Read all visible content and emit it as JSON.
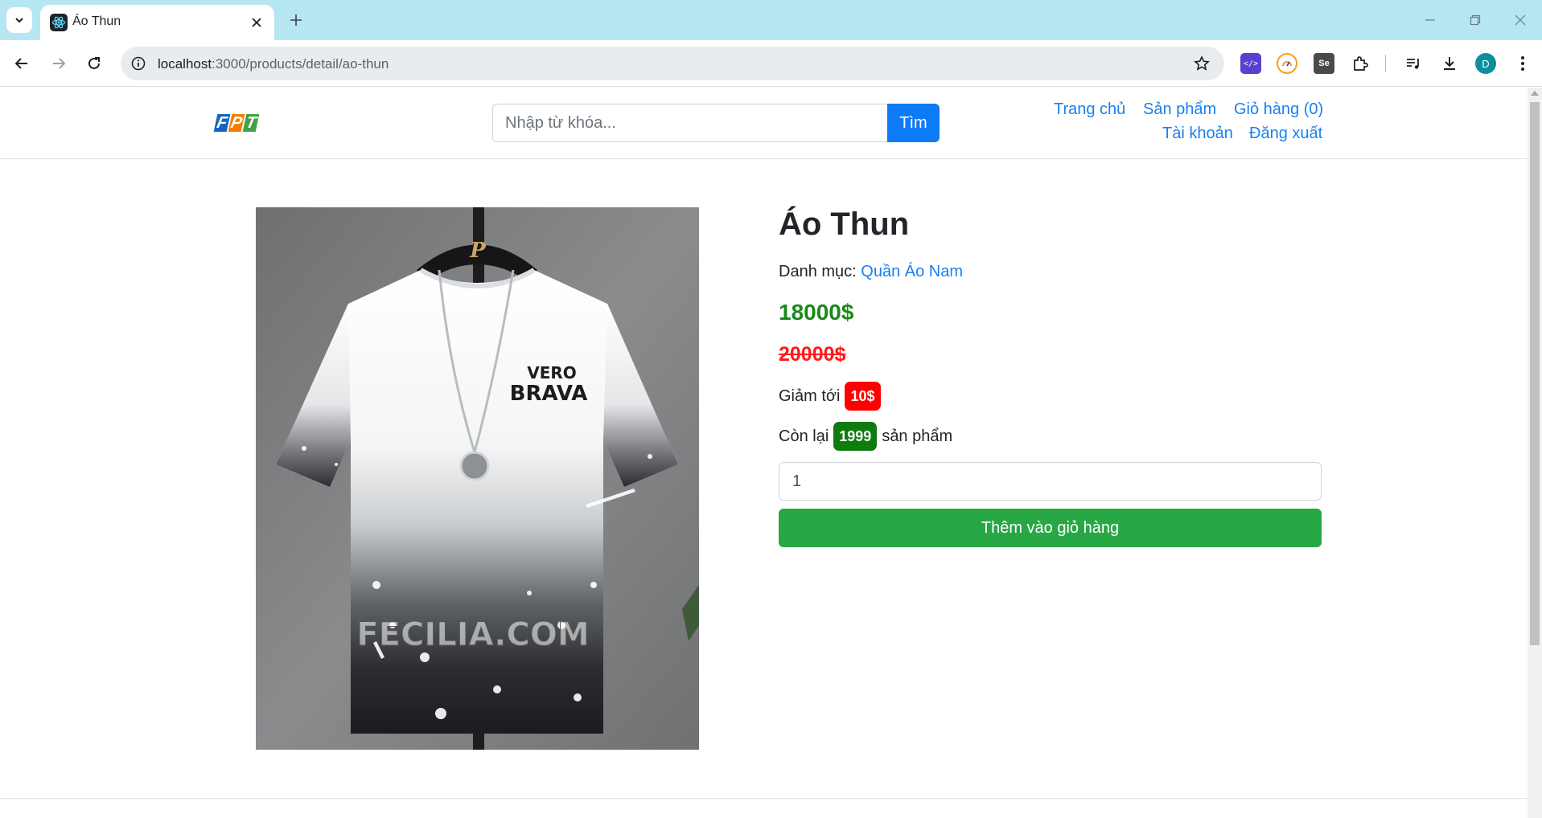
{
  "browser": {
    "tab_title": "Áo Thun",
    "url_host": "localhost",
    "url_path": ":3000/products/detail/ao-thun",
    "avatar_letter": "D",
    "ext_dev_glyph": "</>",
    "ext_se_label": "Se"
  },
  "header": {
    "logo_letters": [
      "F",
      "P",
      "T"
    ],
    "logo_colors": [
      "#1565c0",
      "#f57c00",
      "#43a047"
    ],
    "search_placeholder": "Nhập từ khóa...",
    "search_button": "Tìm",
    "nav": {
      "home": "Trang chủ",
      "products": "Sản phẩm",
      "cart": "Giỏ hàng (0)",
      "account": "Tài khoản",
      "logout": "Đăng xuất"
    }
  },
  "product": {
    "title": "Áo Thun",
    "category_label": "Danh mục:",
    "category_name": "Quần Áo Nam",
    "price": "18000$",
    "old_price": "20000$",
    "discount_label": "Giảm tới",
    "discount_value": "10$",
    "stock_prefix": "Còn lại",
    "stock_count": "1999",
    "stock_suffix": "sản phẩm",
    "quantity": "1",
    "add_to_cart": "Thêm vào giỏ hàng",
    "image": {
      "hanger_logo": "P",
      "shirt_print_line1": "VERO",
      "shirt_print_line2": "BRAVA",
      "watermark": "FECILIA.COM"
    }
  }
}
